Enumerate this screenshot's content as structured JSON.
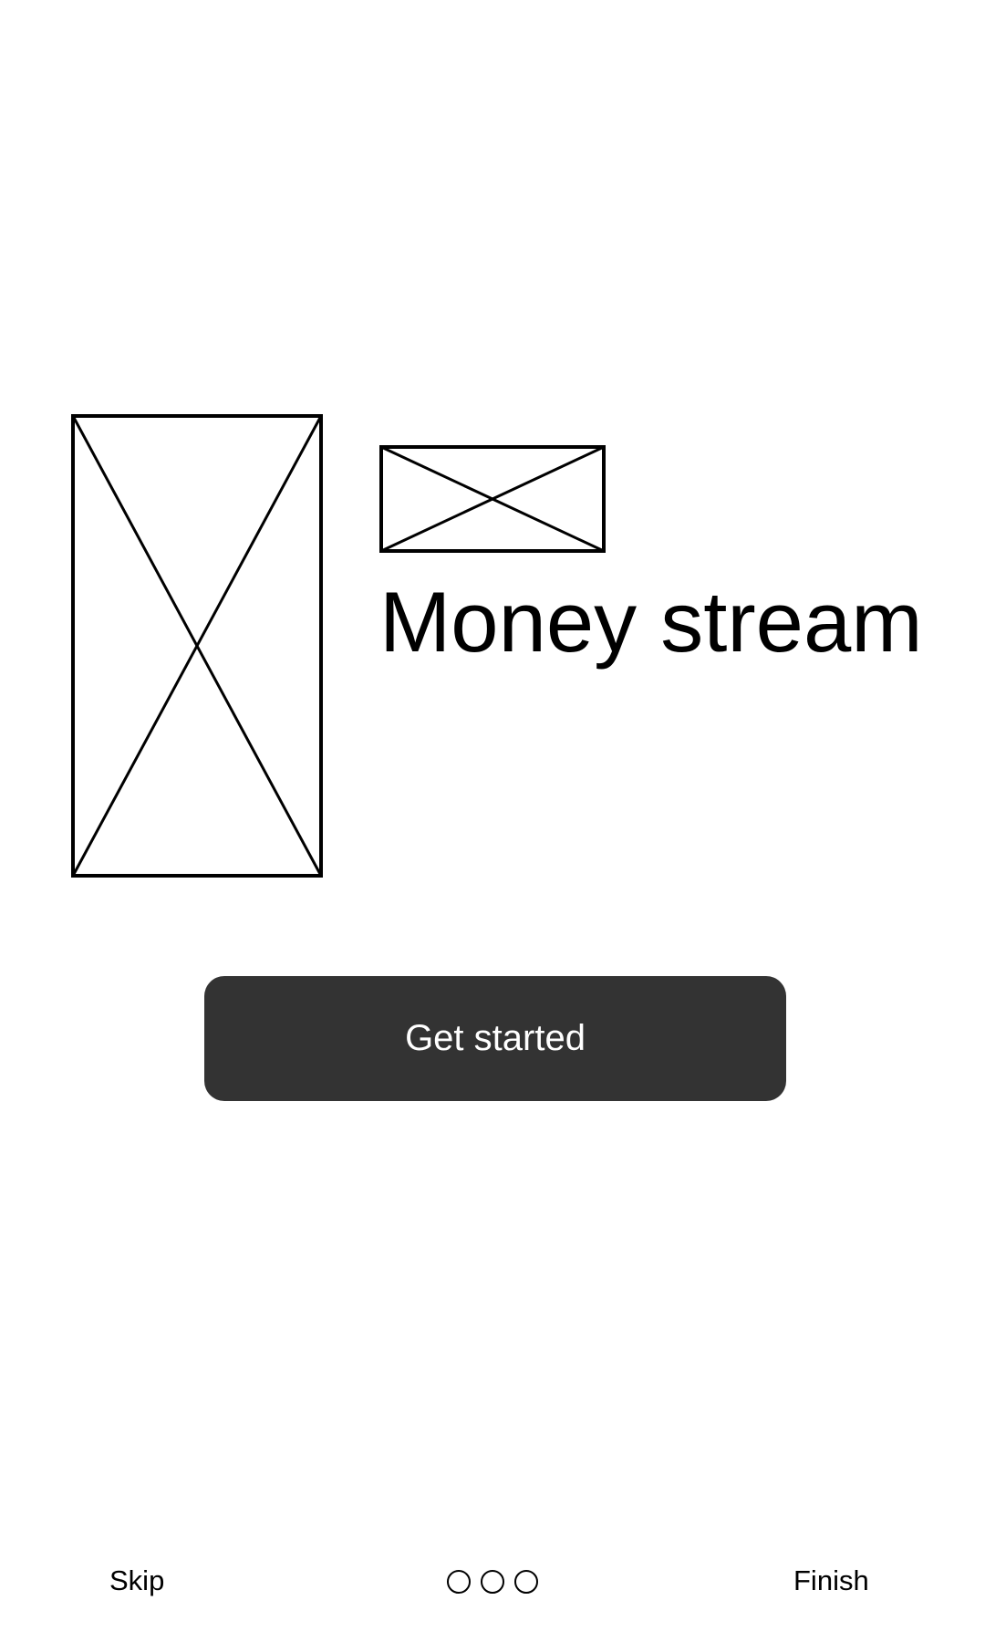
{
  "screen": {
    "title": "Money stream",
    "cta_label": "Get started"
  },
  "placeholders": [
    {
      "name": "image-placeholder-large",
      "kind": "image placeholder"
    },
    {
      "name": "image-placeholder-small",
      "kind": "image placeholder"
    }
  ],
  "footer": {
    "skip_label": "Skip",
    "finish_label": "Finish",
    "pager": {
      "total_pages": 3,
      "current_page": null
    }
  },
  "colors": {
    "background": "#ffffff",
    "text": "#000000",
    "button_background": "#333333",
    "button_text": "#ffffff",
    "placeholder_stroke": "#000000"
  }
}
